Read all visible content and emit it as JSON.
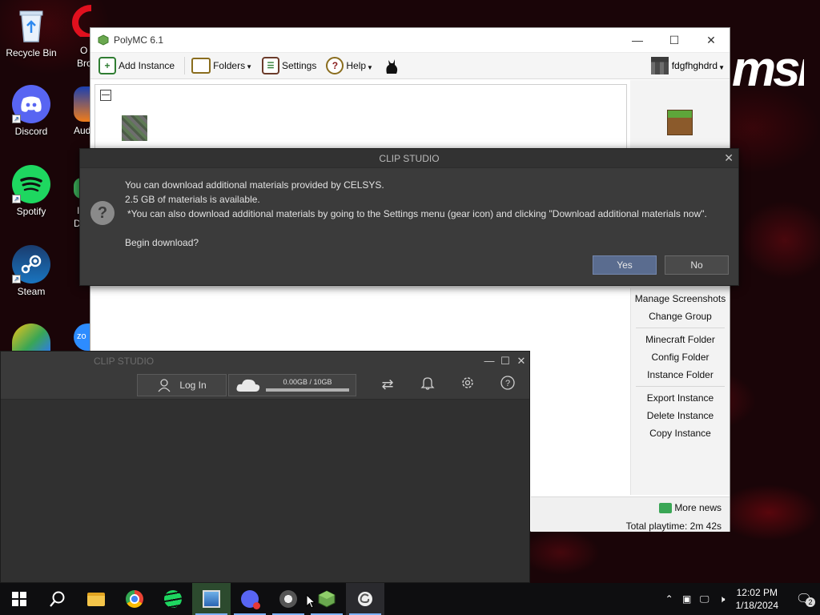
{
  "desktop": {
    "brand_logo": "msi",
    "icons": [
      {
        "label": "Recycle Bin"
      },
      {
        "label": "Discord"
      },
      {
        "label": "Spotify"
      },
      {
        "label": "Steam"
      }
    ],
    "partial_labels": [
      "O",
      "Bro",
      "Aud",
      "I",
      "D"
    ]
  },
  "polymc": {
    "title": "PolyMC 6.1",
    "toolbar": {
      "add_instance": "Add Instance",
      "folders": "Folders",
      "settings": "Settings",
      "help": "Help"
    },
    "account": "fdgfhghdrd",
    "sidebar": {
      "items": [
        "Manage Screenshots",
        "Change Group",
        "Minecraft Folder",
        "Config Folder",
        "Instance Folder",
        "Export Instance",
        "Delete Instance",
        "Copy Instance"
      ]
    },
    "news": "More news",
    "playtime": "Total playtime: 2m 42s"
  },
  "clip_window": {
    "title": "CLIP STUDIO",
    "login": "Log In",
    "storage": "0.00GB / 10GB",
    "storage_fraction": 0
  },
  "dialog": {
    "title": "CLIP STUDIO",
    "line1": "You can download additional materials provided by CELSYS.",
    "line2": "2.5 GB of materials is available.",
    "line3": "*You can also download additional materials by going to the Settings menu (gear icon) and clicking \"Download additional materials now\".",
    "line4": "Begin download?",
    "yes": "Yes",
    "no": "No"
  },
  "taskbar": {
    "time": "12:02 PM",
    "date": "1/18/2024",
    "notifications": "2"
  },
  "colors": {
    "dialog_bg": "#3b3b3b",
    "yes_button": "#5a6c8f",
    "taskbar": "#0e0e10"
  }
}
